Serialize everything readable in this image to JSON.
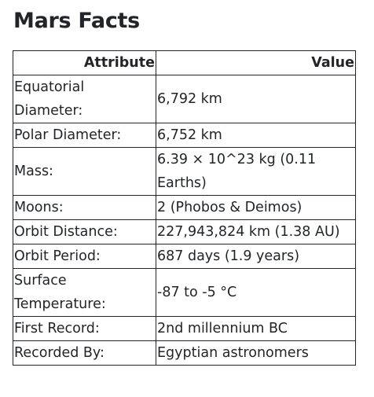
{
  "page": {
    "title": "Mars Facts"
  },
  "table": {
    "headers": {
      "attribute": "Attribute",
      "value": "Value"
    },
    "rows": [
      {
        "attribute": "Equatorial Diameter:",
        "value": "6,792 km"
      },
      {
        "attribute": "Polar Diameter:",
        "value": "6,752 km"
      },
      {
        "attribute": "Mass:",
        "value": "6.39 × 10^23 kg (0.11 Earths)"
      },
      {
        "attribute": "Moons:",
        "value": "2 (Phobos & Deimos)"
      },
      {
        "attribute": "Orbit Distance:",
        "value": "227,943,824 km (1.38 AU)"
      },
      {
        "attribute": "Orbit Period:",
        "value": "687 days (1.9 years)"
      },
      {
        "attribute": "Surface Temperature:",
        "value": "-87 to -5 °C"
      },
      {
        "attribute": "First Record:",
        "value": "2nd millennium BC"
      },
      {
        "attribute": "Recorded By:",
        "value": "Egyptian astronomers"
      }
    ]
  }
}
